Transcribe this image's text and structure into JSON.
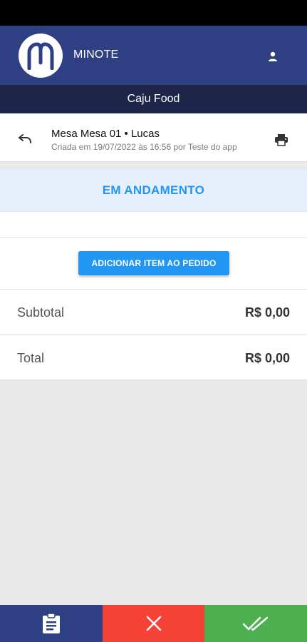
{
  "app": {
    "brand": "MINOTE",
    "establishment": "Caju Food"
  },
  "order": {
    "title": "Mesa Mesa 01 • Lucas",
    "subtitle": "Criada em 19/07/2022 às 16:56 por Teste do app"
  },
  "status": {
    "label": "EM ANDAMENTO"
  },
  "actions": {
    "add_item_label": "ADICIONAR ITEM AO PEDIDO"
  },
  "totals": {
    "subtotal_label": "Subtotal",
    "subtotal_value": "R$ 0,00",
    "total_label": "Total",
    "total_value": "R$ 0,00"
  },
  "colors": {
    "header": "#2e3f84",
    "subheader": "#1d2549",
    "accent": "#2196f3",
    "cancel": "#f44336",
    "confirm": "#4caf50"
  },
  "icons": {
    "logo": "minote-logo",
    "user": "person-icon",
    "back": "undo-icon",
    "print": "printer-icon",
    "orders": "clipboard-icon",
    "cancel": "close-icon",
    "confirm": "double-check-icon"
  }
}
